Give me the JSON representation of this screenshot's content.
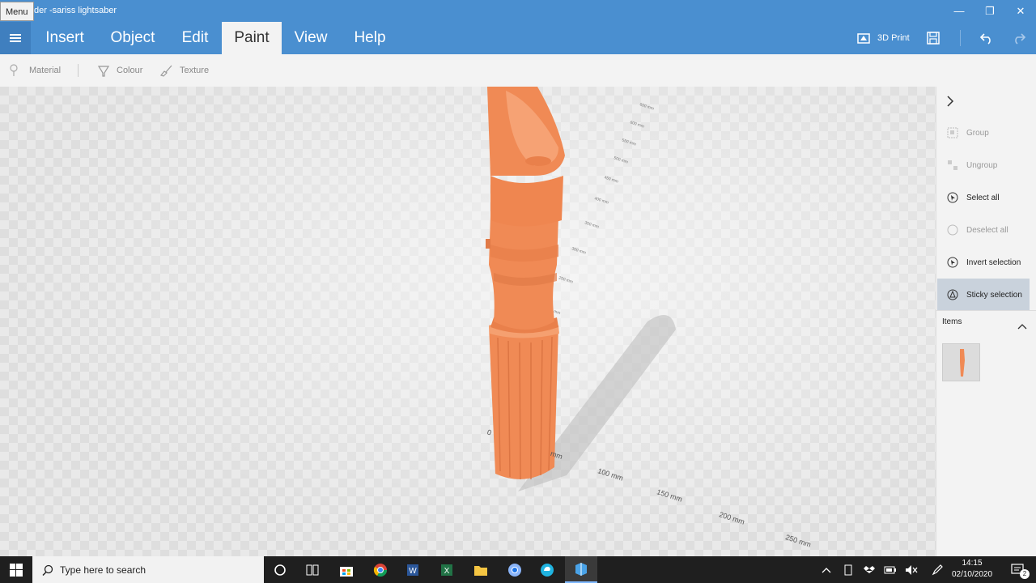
{
  "window": {
    "menu_tooltip": "Menu",
    "title": "der -sariss lightsaber",
    "minimize": "—",
    "maximize": "❐",
    "close": "✕"
  },
  "ribbon": {
    "tabs": [
      {
        "label": "Insert"
      },
      {
        "label": "Object"
      },
      {
        "label": "Edit"
      },
      {
        "label": "Paint",
        "active": true
      },
      {
        "label": "View"
      },
      {
        "label": "Help"
      }
    ],
    "print_label": "3D Print"
  },
  "toolbar": {
    "material": "Material",
    "colour": "Colour",
    "texture": "Texture"
  },
  "panel": {
    "items": [
      {
        "label": "Group",
        "icon": "group-icon",
        "enabled": false
      },
      {
        "label": "Ungroup",
        "icon": "ungroup-icon",
        "enabled": false
      },
      {
        "label": "Select all",
        "icon": "select-all-icon",
        "enabled": true
      },
      {
        "label": "Deselect all",
        "icon": "deselect-all-icon",
        "enabled": false
      },
      {
        "label": "Invert selection",
        "icon": "invert-selection-icon",
        "enabled": true
      },
      {
        "label": "Sticky selection",
        "icon": "sticky-selection-icon",
        "enabled": true,
        "active": true
      }
    ],
    "items_header": "Items"
  },
  "viewport": {
    "model_color": "#f08a55",
    "axis_labels": [
      "0",
      "mm",
      "100 mm",
      "150 mm",
      "200 mm",
      "250 mm"
    ],
    "vertical_ticks": [
      "mm",
      "250 mm",
      "300 mm",
      "350 mm",
      "400 mm",
      "450 mm",
      "500 mm",
      "550 mm",
      "600 mm",
      "650 mm"
    ]
  },
  "taskbar": {
    "search_placeholder": "Type here to search",
    "time": "14:15",
    "date": "02/10/2020",
    "notification_count": "2"
  }
}
